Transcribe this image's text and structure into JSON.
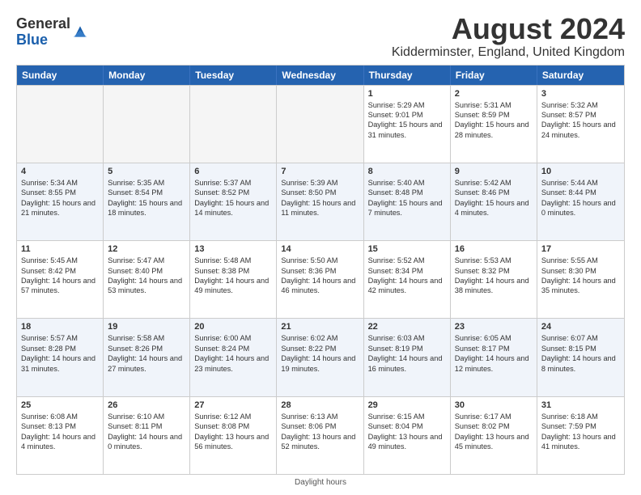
{
  "header": {
    "logo_general": "General",
    "logo_blue": "Blue",
    "main_title": "August 2024",
    "subtitle": "Kidderminster, England, United Kingdom"
  },
  "days_of_week": [
    "Sunday",
    "Monday",
    "Tuesday",
    "Wednesday",
    "Thursday",
    "Friday",
    "Saturday"
  ],
  "footer": "Daylight hours",
  "weeks": [
    [
      {
        "num": "",
        "sunrise": "",
        "sunset": "",
        "daylight": "",
        "empty": true
      },
      {
        "num": "",
        "sunrise": "",
        "sunset": "",
        "daylight": "",
        "empty": true
      },
      {
        "num": "",
        "sunrise": "",
        "sunset": "",
        "daylight": "",
        "empty": true
      },
      {
        "num": "",
        "sunrise": "",
        "sunset": "",
        "daylight": "",
        "empty": true
      },
      {
        "num": "1",
        "sunrise": "Sunrise: 5:29 AM",
        "sunset": "Sunset: 9:01 PM",
        "daylight": "Daylight: 15 hours and 31 minutes."
      },
      {
        "num": "2",
        "sunrise": "Sunrise: 5:31 AM",
        "sunset": "Sunset: 8:59 PM",
        "daylight": "Daylight: 15 hours and 28 minutes."
      },
      {
        "num": "3",
        "sunrise": "Sunrise: 5:32 AM",
        "sunset": "Sunset: 8:57 PM",
        "daylight": "Daylight: 15 hours and 24 minutes."
      }
    ],
    [
      {
        "num": "4",
        "sunrise": "Sunrise: 5:34 AM",
        "sunset": "Sunset: 8:55 PM",
        "daylight": "Daylight: 15 hours and 21 minutes."
      },
      {
        "num": "5",
        "sunrise": "Sunrise: 5:35 AM",
        "sunset": "Sunset: 8:54 PM",
        "daylight": "Daylight: 15 hours and 18 minutes."
      },
      {
        "num": "6",
        "sunrise": "Sunrise: 5:37 AM",
        "sunset": "Sunset: 8:52 PM",
        "daylight": "Daylight: 15 hours and 14 minutes."
      },
      {
        "num": "7",
        "sunrise": "Sunrise: 5:39 AM",
        "sunset": "Sunset: 8:50 PM",
        "daylight": "Daylight: 15 hours and 11 minutes."
      },
      {
        "num": "8",
        "sunrise": "Sunrise: 5:40 AM",
        "sunset": "Sunset: 8:48 PM",
        "daylight": "Daylight: 15 hours and 7 minutes."
      },
      {
        "num": "9",
        "sunrise": "Sunrise: 5:42 AM",
        "sunset": "Sunset: 8:46 PM",
        "daylight": "Daylight: 15 hours and 4 minutes."
      },
      {
        "num": "10",
        "sunrise": "Sunrise: 5:44 AM",
        "sunset": "Sunset: 8:44 PM",
        "daylight": "Daylight: 15 hours and 0 minutes."
      }
    ],
    [
      {
        "num": "11",
        "sunrise": "Sunrise: 5:45 AM",
        "sunset": "Sunset: 8:42 PM",
        "daylight": "Daylight: 14 hours and 57 minutes."
      },
      {
        "num": "12",
        "sunrise": "Sunrise: 5:47 AM",
        "sunset": "Sunset: 8:40 PM",
        "daylight": "Daylight: 14 hours and 53 minutes."
      },
      {
        "num": "13",
        "sunrise": "Sunrise: 5:48 AM",
        "sunset": "Sunset: 8:38 PM",
        "daylight": "Daylight: 14 hours and 49 minutes."
      },
      {
        "num": "14",
        "sunrise": "Sunrise: 5:50 AM",
        "sunset": "Sunset: 8:36 PM",
        "daylight": "Daylight: 14 hours and 46 minutes."
      },
      {
        "num": "15",
        "sunrise": "Sunrise: 5:52 AM",
        "sunset": "Sunset: 8:34 PM",
        "daylight": "Daylight: 14 hours and 42 minutes."
      },
      {
        "num": "16",
        "sunrise": "Sunrise: 5:53 AM",
        "sunset": "Sunset: 8:32 PM",
        "daylight": "Daylight: 14 hours and 38 minutes."
      },
      {
        "num": "17",
        "sunrise": "Sunrise: 5:55 AM",
        "sunset": "Sunset: 8:30 PM",
        "daylight": "Daylight: 14 hours and 35 minutes."
      }
    ],
    [
      {
        "num": "18",
        "sunrise": "Sunrise: 5:57 AM",
        "sunset": "Sunset: 8:28 PM",
        "daylight": "Daylight: 14 hours and 31 minutes."
      },
      {
        "num": "19",
        "sunrise": "Sunrise: 5:58 AM",
        "sunset": "Sunset: 8:26 PM",
        "daylight": "Daylight: 14 hours and 27 minutes."
      },
      {
        "num": "20",
        "sunrise": "Sunrise: 6:00 AM",
        "sunset": "Sunset: 8:24 PM",
        "daylight": "Daylight: 14 hours and 23 minutes."
      },
      {
        "num": "21",
        "sunrise": "Sunrise: 6:02 AM",
        "sunset": "Sunset: 8:22 PM",
        "daylight": "Daylight: 14 hours and 19 minutes."
      },
      {
        "num": "22",
        "sunrise": "Sunrise: 6:03 AM",
        "sunset": "Sunset: 8:19 PM",
        "daylight": "Daylight: 14 hours and 16 minutes."
      },
      {
        "num": "23",
        "sunrise": "Sunrise: 6:05 AM",
        "sunset": "Sunset: 8:17 PM",
        "daylight": "Daylight: 14 hours and 12 minutes."
      },
      {
        "num": "24",
        "sunrise": "Sunrise: 6:07 AM",
        "sunset": "Sunset: 8:15 PM",
        "daylight": "Daylight: 14 hours and 8 minutes."
      }
    ],
    [
      {
        "num": "25",
        "sunrise": "Sunrise: 6:08 AM",
        "sunset": "Sunset: 8:13 PM",
        "daylight": "Daylight: 14 hours and 4 minutes."
      },
      {
        "num": "26",
        "sunrise": "Sunrise: 6:10 AM",
        "sunset": "Sunset: 8:11 PM",
        "daylight": "Daylight: 14 hours and 0 minutes."
      },
      {
        "num": "27",
        "sunrise": "Sunrise: 6:12 AM",
        "sunset": "Sunset: 8:08 PM",
        "daylight": "Daylight: 13 hours and 56 minutes."
      },
      {
        "num": "28",
        "sunrise": "Sunrise: 6:13 AM",
        "sunset": "Sunset: 8:06 PM",
        "daylight": "Daylight: 13 hours and 52 minutes."
      },
      {
        "num": "29",
        "sunrise": "Sunrise: 6:15 AM",
        "sunset": "Sunset: 8:04 PM",
        "daylight": "Daylight: 13 hours and 49 minutes."
      },
      {
        "num": "30",
        "sunrise": "Sunrise: 6:17 AM",
        "sunset": "Sunset: 8:02 PM",
        "daylight": "Daylight: 13 hours and 45 minutes."
      },
      {
        "num": "31",
        "sunrise": "Sunrise: 6:18 AM",
        "sunset": "Sunset: 7:59 PM",
        "daylight": "Daylight: 13 hours and 41 minutes."
      }
    ]
  ]
}
